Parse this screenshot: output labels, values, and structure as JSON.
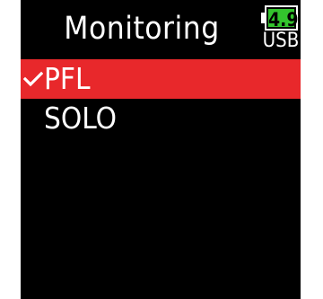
{
  "screen": {
    "title": "Monitoring",
    "battery": {
      "level": "4.9",
      "source": "USB",
      "fill_color": "#33c42d"
    },
    "accent_color": "#e8282b"
  },
  "menu": {
    "items": [
      {
        "label": "PFL",
        "checked": true,
        "selected": true
      },
      {
        "label": "SOLO",
        "checked": false,
        "selected": false
      }
    ]
  }
}
